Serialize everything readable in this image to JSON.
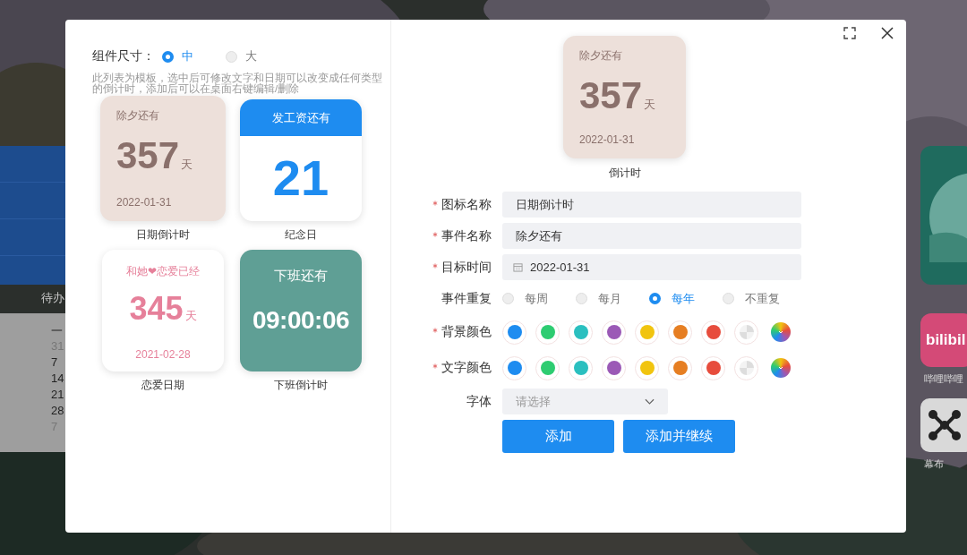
{
  "desktop": {
    "todo_label": "待办",
    "calendar": {
      "weekday": "一",
      "days": [
        {
          "text": "31",
          "muted": true
        },
        {
          "text": "7",
          "muted": false
        },
        {
          "text": "14",
          "muted": false
        },
        {
          "text": "21",
          "muted": false
        },
        {
          "text": "28",
          "muted": false
        },
        {
          "text": "7",
          "muted": true
        }
      ]
    },
    "apps": [
      {
        "kind": "teal"
      },
      {
        "kind": "bilibili",
        "logo": "bilibil",
        "label": "哔哩哔哩"
      },
      {
        "kind": "mubu",
        "label": "幕布"
      }
    ]
  },
  "dialog": {
    "size": {
      "label": "组件尺寸：",
      "options": [
        {
          "label": "中",
          "selected": true
        },
        {
          "label": "大",
          "selected": false
        }
      ]
    },
    "hint": "此列表为模板，选中后可修改文字和日期可以改变成任何类型的倒计时，添加后可以在桌面右键编辑/删除",
    "templates": [
      {
        "kind": "date",
        "title": "除夕还有",
        "number": "357",
        "unit": "天",
        "date": "2022-01-31",
        "name": "日期倒计时"
      },
      {
        "kind": "anniversary",
        "title": "发工资还有",
        "number": "21",
        "name": "纪念日"
      },
      {
        "kind": "love",
        "title": "和她❤恋爱已经",
        "number": "345",
        "unit": "天",
        "date": "2021-02-28",
        "name": "恋爱日期"
      },
      {
        "kind": "work",
        "title": "下班还有",
        "number": "09:00:06",
        "name": "下班倒计时"
      }
    ],
    "preview": {
      "kind": "date",
      "title": "除夕还有",
      "number": "357",
      "unit": "天",
      "date": "2022-01-31",
      "name": "倒计时"
    },
    "fields": [
      {
        "kind": "text",
        "label": "图标名称",
        "required": true,
        "value": "日期倒计时"
      },
      {
        "kind": "text",
        "label": "事件名称",
        "required": true,
        "value": "除夕还有"
      },
      {
        "kind": "date",
        "label": "目标时间",
        "required": true,
        "value": "2022-01-31"
      }
    ],
    "repeat": {
      "label": "事件重复",
      "required": false,
      "options": [
        {
          "label": "每周",
          "selected": false
        },
        {
          "label": "每月",
          "selected": false
        },
        {
          "label": "每年",
          "selected": true
        },
        {
          "label": "不重复",
          "selected": false
        }
      ]
    },
    "color_rows": [
      {
        "label": "背景颜色",
        "required": true,
        "swatches": [
          {
            "kind": "solid",
            "color": "#1e8cf0"
          },
          {
            "kind": "solid",
            "color": "#2ecc71"
          },
          {
            "kind": "solid",
            "color": "#2bbfbf"
          },
          {
            "kind": "solid",
            "color": "#9b59b6"
          },
          {
            "kind": "solid",
            "color": "#f1c40f"
          },
          {
            "kind": "solid",
            "color": "#e67e22"
          },
          {
            "kind": "solid",
            "color": "#e74c3c"
          },
          {
            "kind": "none"
          },
          {
            "kind": "picker"
          }
        ]
      },
      {
        "label": "文字颜色",
        "required": true,
        "swatches": [
          {
            "kind": "solid",
            "color": "#1e8cf0"
          },
          {
            "kind": "solid",
            "color": "#2ecc71"
          },
          {
            "kind": "solid",
            "color": "#2bbfbf"
          },
          {
            "kind": "solid",
            "color": "#9b59b6"
          },
          {
            "kind": "solid",
            "color": "#f1c40f"
          },
          {
            "kind": "solid",
            "color": "#e67e22"
          },
          {
            "kind": "solid",
            "color": "#e74c3c"
          },
          {
            "kind": "none"
          },
          {
            "kind": "picker"
          }
        ]
      }
    ],
    "font": {
      "label": "字体",
      "required": false,
      "placeholder": "请选择"
    },
    "buttons": [
      "添加",
      "添加并继续"
    ]
  }
}
